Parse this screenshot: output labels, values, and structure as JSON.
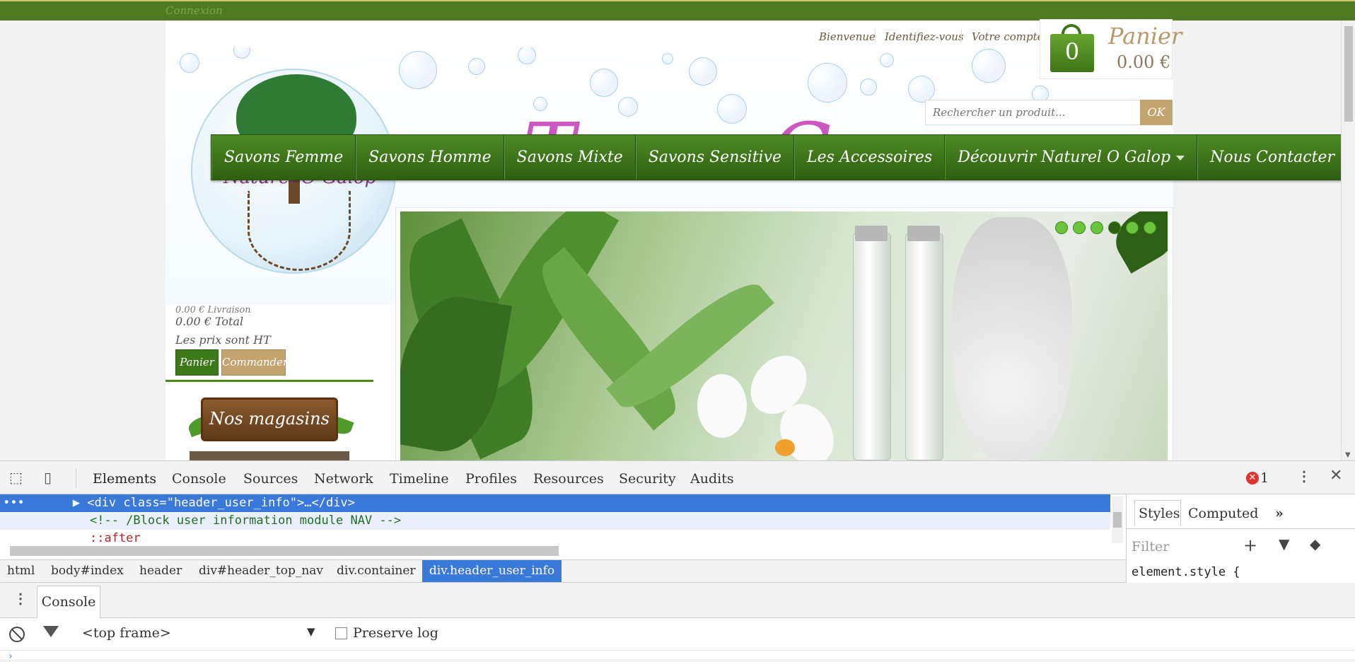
{
  "topbar": {
    "connexion": "Connexion"
  },
  "header": {
    "user_links": [
      "Bienvenue",
      "Identifiez-vous",
      "Votre compte"
    ],
    "cart": {
      "count": "0",
      "label": "Panier",
      "amount": "0.00 €"
    },
    "search": {
      "placeholder": "Rechercher un produit...",
      "button": "OK"
    }
  },
  "nav": {
    "items": [
      "Savons Femme",
      "Savons Homme",
      "Savons Mixte",
      "Savons Sensitive",
      "Les Accessoires",
      "Découvrir Naturel O Galop",
      "Nous Contacter"
    ]
  },
  "logo": {
    "text": "Naturel O Galop"
  },
  "sidebar": {
    "livraison": "0.00 € Livraison",
    "total": "0.00 € Total",
    "prix_note": "Les prix sont HT",
    "btn_panier": "Panier",
    "btn_commander": "Commander",
    "shops_title": "Nos magasins"
  },
  "slider": {
    "dots": 6,
    "active_dot": 4
  },
  "devtools": {
    "tabs": [
      "Elements",
      "Console",
      "Sources",
      "Network",
      "Timeline",
      "Profiles",
      "Resources",
      "Security",
      "Audits"
    ],
    "error_count": "1",
    "code": {
      "line1_prefix": "▶ ",
      "line1": "<div class=\"header_user_info\">…</div>",
      "line2": "<!-- /Block user information module NAV -->",
      "line3": "::after"
    },
    "styles_tabs": [
      "Styles",
      "Computed"
    ],
    "filter_placeholder": "Filter",
    "element_style": "element.style {",
    "breadcrumbs": [
      "html",
      "body#index",
      "header",
      "div#header_top_nav",
      "div.container"
    ],
    "breadcrumb_active": "div.header_user_info",
    "drawer_tab": "Console",
    "console_context": "<top frame>",
    "preserve_log": "Preserve log"
  },
  "colors": {
    "brand_green": "#4f7a23",
    "accent_tan": "#c4a46e",
    "devtools_blue": "#3879d9"
  }
}
